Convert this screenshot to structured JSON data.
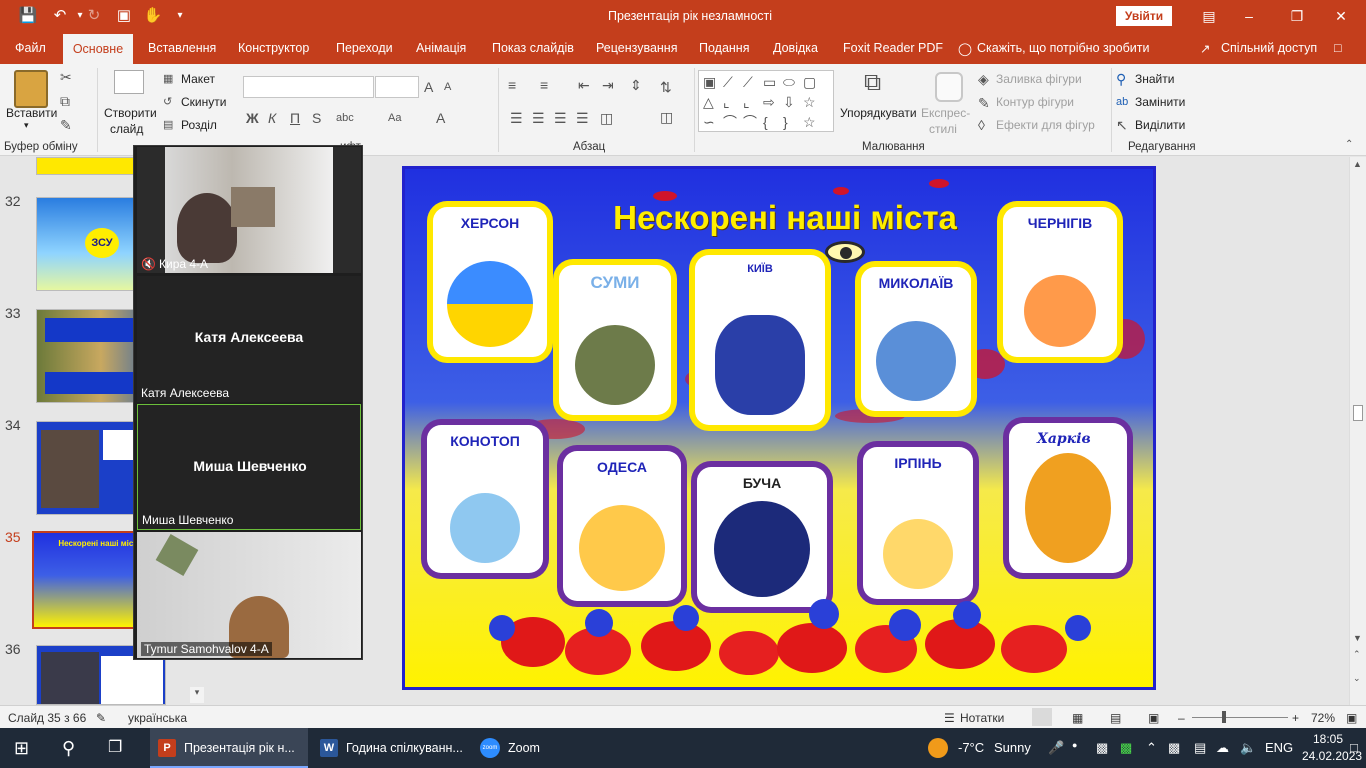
{
  "window": {
    "title": "Презентація рік незламності",
    "sign_in": "Увійти"
  },
  "menu": {
    "tabs": [
      "Файл",
      "Основне",
      "Вставлення",
      "Конструктор",
      "Переходи",
      "Анімація",
      "Показ слайдів",
      "Рецензування",
      "Подання",
      "Довідка",
      "Foxit Reader PDF"
    ],
    "tell_me": "Скажіть, що потрібно зробити",
    "share": "Спільний доступ"
  },
  "ribbon": {
    "clipboard": {
      "paste": "Вставити",
      "label": "Буфер обміну"
    },
    "slides": {
      "new_slide_1": "Створити",
      "new_slide_2": "слайд",
      "layout": "Макет",
      "reset": "Скинути",
      "section": "Розділ",
      "label_tail": "ифт"
    },
    "paragraph": {
      "label": "Абзац"
    },
    "drawing": {
      "arrange": "Упорядкувати",
      "styles_1": "Експрес-",
      "styles_2": "стилі",
      "fill": "Заливка фігури",
      "outline": "Контур фігури",
      "effects": "Ефекти для фігур",
      "label": "Малювання"
    },
    "editing": {
      "find": "Знайти",
      "replace": "Замінити",
      "select": "Виділити",
      "label": "Редагування"
    }
  },
  "thumbnails": [
    {
      "num": "32",
      "top_text": "ЗСУ"
    },
    {
      "num": "33",
      "top_text": ""
    },
    {
      "num": "34",
      "top_text": ""
    },
    {
      "num": "35",
      "top_text": "Нескорені наші міста",
      "active": true
    },
    {
      "num": "36",
      "top_text": ""
    }
  ],
  "zoom": {
    "participants": [
      {
        "name": "Кира 4-А",
        "muted": true,
        "video": true
      },
      {
        "name": "Катя Алексеева",
        "display": "Катя Алексеева",
        "video": false
      },
      {
        "name": "Миша Шевченко",
        "display": "Миша Шевченко",
        "video": false,
        "speaking": true
      },
      {
        "name": "Tymur Samohvalov 4-A",
        "video": true
      }
    ]
  },
  "slide": {
    "title": "Нескорені наші міста",
    "cities": {
      "kherson": "ХЕРСОН",
      "sumy": "СУМИ",
      "kyiv": "КИЇВ",
      "mykolaiv": "МИКОЛАЇВ",
      "chernihiv": "ЧЕРНІГІВ",
      "konotop": "КОНОТОП",
      "odesa": "ОДЕСА",
      "bucha": "БУЧА",
      "irpin": "ІРПІНЬ",
      "kharkiv": "Харків"
    }
  },
  "statusbar": {
    "slide_counter": "Слайд 35 з 66",
    "language": "українська",
    "notes": "Нотатки",
    "zoom_level": "72%"
  },
  "taskbar": {
    "apps": [
      {
        "label": "Презентація рік н...",
        "icon": "powerpoint-icon"
      },
      {
        "label": "Година спілкуванн...",
        "icon": "word-icon"
      },
      {
        "label": "Zoom",
        "icon": "zoom-icon"
      }
    ],
    "weather_temp": "-7°C",
    "weather_text": "Sunny",
    "lang": "ENG",
    "time": "18:05",
    "date": "24.02.2023"
  }
}
